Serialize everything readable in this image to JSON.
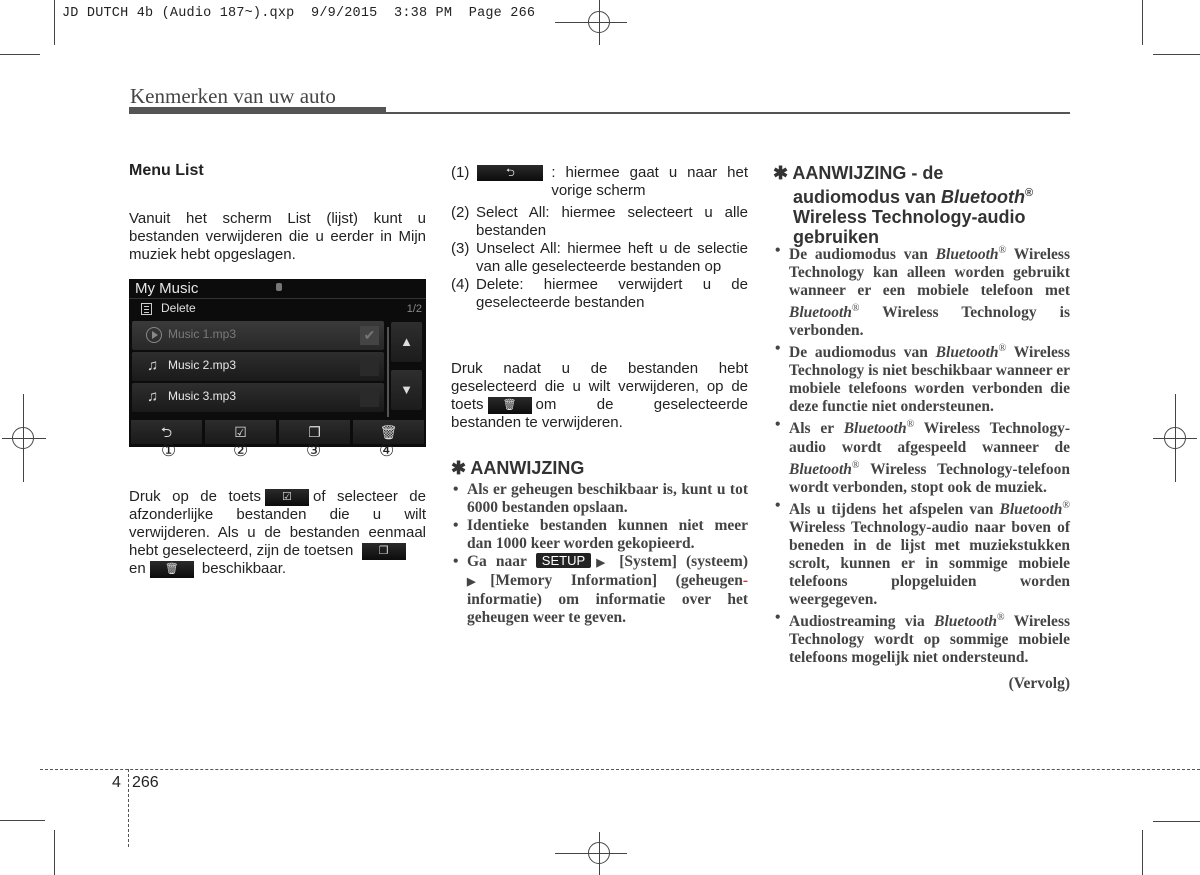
{
  "slug": {
    "text": "JD DUTCH 4b (Audio 187~).qxp  9/9/2015  3:38 PM  Page 266"
  },
  "running_head": "Kenmerken van uw auto",
  "left_column": {
    "heading": "Menu List",
    "intro": "Vanuit het scherm List (lijst) kunt u bestanden verwijderen die u eerder in Mijn muziek hebt opgeslagen.",
    "screen": {
      "title": "My Music",
      "menu_label": "Delete",
      "page_indicator": "1/2",
      "rows": [
        {
          "name": "Music 1.mp3",
          "icon": "play-circle-icon",
          "checked": true
        },
        {
          "name": "Music 2.mp3",
          "icon": "music-note-icon",
          "checked": false
        },
        {
          "name": "Music 3.mp3",
          "icon": "music-note-icon",
          "checked": false
        }
      ],
      "scroll_up": "▲",
      "scroll_down": "▼",
      "buttons": [
        {
          "icon": "back-icon",
          "glyph": "⮌"
        },
        {
          "icon": "select-all-icon",
          "glyph": "☑"
        },
        {
          "icon": "unselect-all-icon",
          "glyph": "❐"
        },
        {
          "icon": "trash-icon",
          "glyph": "🗑"
        }
      ],
      "callouts": [
        "①",
        "②",
        "③",
        "④"
      ]
    },
    "druk_text": {
      "part1": "Druk op de toets",
      "part2": "of selecteer de afzonderlijke bestanden die u wilt verwijderen. Als u de bestanden eenmaal hebt geselecteerd, zijn de toetsen",
      "part3": "en",
      "part4": "beschikbaar."
    }
  },
  "middle_column": {
    "definitions": [
      {
        "num": "(1)",
        "text": ": hiermee gaat u naar het vorige scherm",
        "has_icon": true
      },
      {
        "num": "(2)",
        "text": "Select All: hiermee selecteert u alle bestanden"
      },
      {
        "num": "(3)",
        "text": "Unselect All: hiermee heft u de selectie van alle geselecteerde bestanden op"
      },
      {
        "num": "(4)",
        "text": "Delete: hiermee verwijdert u de geselecteerde bestanden"
      }
    ],
    "druk2": {
      "part1": "Druk nadat u de bestanden hebt geselecteerd die u wilt verwijderen, op de toets",
      "part2": "om de geselecteerde bestanden te verwijderen."
    },
    "note_heading": "✱ AANWIJZING",
    "notes": [
      "Als er geheugen beschikbaar is, kunt u tot 6000 bestanden opslaan.",
      "Identieke bestanden kunnen niet meer dan 1000 keer worden gekopieerd."
    ],
    "setup_note": {
      "prefix": "Ga naar",
      "badge": "SETUP",
      "arrow": "▶",
      "text1": "[System] (systeem)",
      "text2": "[Memory Information] (geheugen",
      "hyphen": "-",
      "text3": "informatie) om informatie over het geheugen weer te geven."
    }
  },
  "right_column": {
    "note_heading_line1": "✱ AANWIJZING - de",
    "note_heading_line2a": "audiomodus van ",
    "note_heading_bt": "Bluetooth",
    "note_heading_reg": "®",
    "note_heading_line3": "Wireless Technology-audio gebruiken",
    "bullets": [
      "De audiomodus van Bluetooth® Wireless Technology kan alleen worden gebruikt wanneer er een mobiele telefoon met Bluetooth® Wireless Technology is verbonden.",
      "De audiomodus van Bluetooth® Wireless Technology is niet beschikbaar wanneer er mobiele telefoons worden verbonden die deze functie niet ondersteunen.",
      "Als er Bluetooth® Wireless Technology-audio wordt afgespeeld wanneer de Bluetooth® Wireless Technology-telefoon wordt verbonden, stopt ook de muziek.",
      "Als u tijdens het afspelen van Bluetooth® Wireless Technology-audio naar boven of beneden in de lijst met muziekstukken scrolt, kunnen er in sommige mobiele telefoons plopgeluiden worden weergegeven.",
      "Audiostreaming via Bluetooth® Wireless Technology wordt op sommige mobiele telefoons mogelijk niet ondersteund."
    ],
    "continued": "(Vervolg)"
  },
  "footer": {
    "chapter": "4",
    "page": "266"
  }
}
